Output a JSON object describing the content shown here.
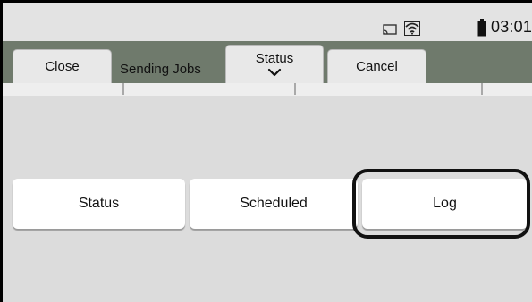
{
  "status_bar": {
    "time": "03:01",
    "icons": [
      "cast-icon",
      "wifi-icon",
      "battery-icon"
    ]
  },
  "toolbar": {
    "close_label": "Close",
    "title": "Sending Jobs",
    "status_label": "Status",
    "cancel_label": "Cancel"
  },
  "tabs": [
    {
      "label": "Status"
    },
    {
      "label": "Scheduled"
    },
    {
      "label": "Log",
      "highlighted": true
    }
  ],
  "colors": {
    "toolbar_bg": "#6f7a6c",
    "content_bg": "#dcdcdc",
    "button_bg": "#ffffff",
    "highlight": "#111111"
  }
}
